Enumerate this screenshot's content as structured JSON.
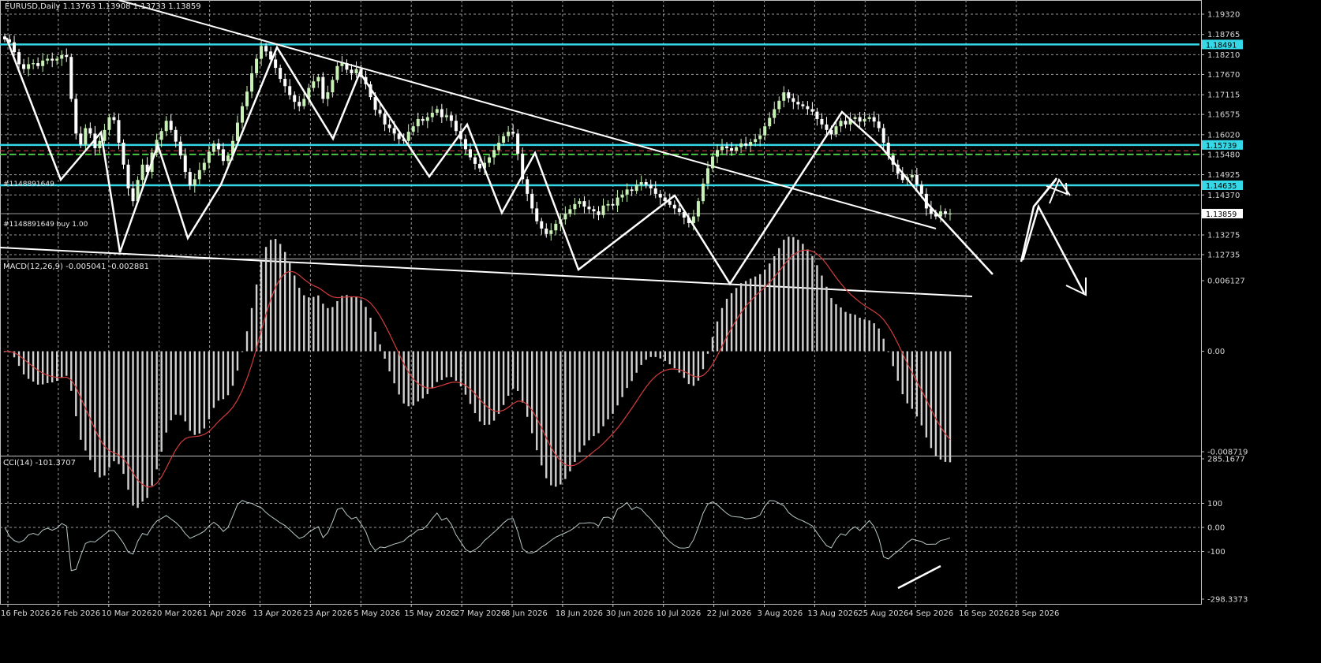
{
  "header": {
    "symbol_line": "EURUSD,Daily 1.13763 1.13908 1.13733 1.13859"
  },
  "colors": {
    "background": "#000000",
    "bull_candle": "#c7f1b5",
    "bear_candle": "#ffffff",
    "level_line": "#35d8e6",
    "order_line": "#49c944",
    "stop_line": "#d84a4a",
    "zigzag": "#ffffff",
    "macd_hist": "#d0d0d0",
    "macd_signal": "#d23c3c",
    "cci_line": "#b8c8c8",
    "grid": "#9c9c9c",
    "price_marker_bg": "#ffffff",
    "price_marker_text": "#000000"
  },
  "order_labels": {
    "top_label": "#1148891649",
    "buy_label": "#1148891649 buy 1.00"
  },
  "chart_data": [
    {
      "type": "candlestick",
      "name": "price",
      "ylim": [
        1.12735,
        1.1932
      ],
      "y_ticks": [
        "1.19320",
        "1.18765",
        "1.18210",
        "1.17670",
        "1.17115",
        "1.16575",
        "1.16020",
        "1.15480",
        "1.14925",
        "1.14370",
        "1.13275",
        "1.12735"
      ],
      "x_labels": [
        "16 Feb 2026",
        "26 Feb 2026",
        "10 Mar 2026",
        "20 Mar 2026",
        "1 Apr 2026",
        "13 Apr 2026",
        "23 Apr 2026",
        "5 May 2026",
        "15 May 2026",
        "27 May 2026",
        "8 Jun 2026",
        "18 Jun 2026",
        "30 Jun 2026",
        "10 Jul 2026",
        "22 Jul 2026",
        "3 Aug 2026",
        "13 Aug 2026",
        "25 Aug 2026",
        "4 Sep 2026",
        "16 Sep 2026",
        "28 Sep 2026"
      ],
      "closes": [
        1.1863,
        1.1855,
        1.1828,
        1.1795,
        1.1782,
        1.1795,
        1.1798,
        1.179,
        1.1805,
        1.181,
        1.1805,
        1.181,
        1.182,
        1.1815,
        1.17,
        1.1605,
        1.1575,
        1.162,
        1.1605,
        1.1565,
        1.1585,
        1.1615,
        1.165,
        1.1642,
        1.158,
        1.152,
        1.1455,
        1.142,
        1.1478,
        1.152,
        1.15,
        1.1553,
        1.1588,
        1.1612,
        1.164,
        1.1615,
        1.1583,
        1.1545,
        1.15,
        1.1463,
        1.148,
        1.1505,
        1.1525,
        1.1555,
        1.1578,
        1.1562,
        1.153,
        1.1545,
        1.1585,
        1.1635,
        1.168,
        1.172,
        1.177,
        1.181,
        1.1845,
        1.183,
        1.1808,
        1.1785,
        1.1755,
        1.1735,
        1.171,
        1.1692,
        1.168,
        1.17,
        1.173,
        1.1748,
        1.176,
        1.17,
        1.1718,
        1.1752,
        1.179,
        1.1798,
        1.178,
        1.177,
        1.1782,
        1.176,
        1.174,
        1.1705,
        1.167,
        1.166,
        1.163,
        1.162,
        1.1605,
        1.159,
        1.1585,
        1.161,
        1.1625,
        1.1645,
        1.164,
        1.165,
        1.1662,
        1.1672,
        1.165,
        1.1655,
        1.164,
        1.1612,
        1.159,
        1.1562,
        1.154,
        1.1522,
        1.151,
        1.1525,
        1.154,
        1.156,
        1.158,
        1.1598,
        1.161,
        1.1605,
        1.155,
        1.148,
        1.144,
        1.14,
        1.1365,
        1.1345,
        1.133,
        1.134,
        1.1358,
        1.137,
        1.1385,
        1.1398,
        1.1412,
        1.142,
        1.1405,
        1.1398,
        1.1392,
        1.1382,
        1.1408,
        1.1412,
        1.1408,
        1.143,
        1.1438,
        1.1452,
        1.1448,
        1.1465,
        1.1472,
        1.1465,
        1.1455,
        1.144,
        1.143,
        1.142,
        1.141,
        1.14,
        1.139,
        1.1375,
        1.136,
        1.1378,
        1.142,
        1.1468,
        1.151,
        1.1542,
        1.156,
        1.157,
        1.1565,
        1.1558,
        1.1568,
        1.1578,
        1.1572,
        1.1582,
        1.159,
        1.16,
        1.1625,
        1.1648,
        1.1672,
        1.1695,
        1.1718,
        1.1702,
        1.1692,
        1.1685,
        1.168,
        1.1672,
        1.1665,
        1.1645,
        1.163,
        1.1615,
        1.1603,
        1.1625,
        1.164,
        1.163,
        1.1645,
        1.165,
        1.1638,
        1.1645,
        1.165,
        1.1638,
        1.162,
        1.158,
        1.1545,
        1.152,
        1.1495,
        1.1478,
        1.1485,
        1.1492,
        1.1465,
        1.144,
        1.14,
        1.1385,
        1.1378,
        1.1392,
        1.1385,
        1.1386
      ]
    },
    {
      "type": "histogram+line",
      "name": "macd",
      "title": "MACD(12,26,9) -0.005041 -0.002881",
      "ylim": [
        -0.008719,
        0.006127
      ],
      "y_ticks": [
        "0.006127",
        "0.00",
        "-0.008719"
      ]
    },
    {
      "type": "line",
      "name": "cci",
      "title": "CCI(14) -101.3707",
      "ylim": [
        -298.3373,
        285.1677
      ],
      "y_ticks": [
        "285.1677",
        "100",
        "0.00",
        "-100",
        "-298.3373"
      ]
    }
  ],
  "price_levels": [
    {
      "label": "1.18491",
      "value": 1.18491,
      "kind": "resistance"
    },
    {
      "label": "1.15739",
      "value": 1.15739,
      "kind": "resistance"
    },
    {
      "label": "1.14635",
      "value": 1.14635,
      "kind": "support"
    },
    {
      "label": "1.13859",
      "value": 1.13859,
      "kind": "current"
    }
  ],
  "order_line_value": 1.1548,
  "stop_line_value": 1.1558
}
